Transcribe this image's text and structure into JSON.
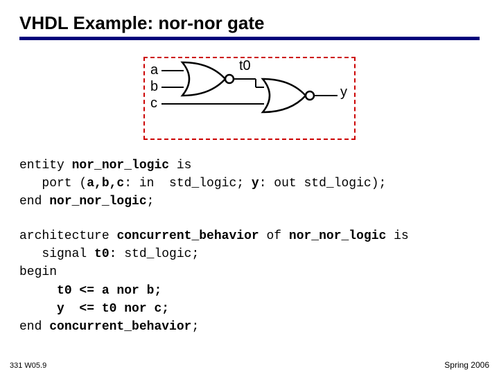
{
  "title": "VHDL Example: nor-nor gate",
  "labels": {
    "a": "a",
    "b": "b",
    "c": "c",
    "t0": "t0",
    "y": "y"
  },
  "code1": {
    "l1a": "entity ",
    "l1b": "nor_nor_logic",
    "l1c": " is",
    "l2a": "   port (",
    "l2b": "a,b,c",
    "l2c": ": in  std_logic; ",
    "l2d": "y",
    "l2e": ": out std_logic);",
    "l3a": "end ",
    "l3b": "nor_nor_logic",
    "l3c": ";"
  },
  "code2": {
    "l1a": "architecture ",
    "l1b": "concurrent_behavior",
    "l1c": " of ",
    "l1d": "nor_nor_logic",
    "l1e": " is",
    "l2a": "   signal ",
    "l2b": "t0",
    "l2c": ": std_logic;",
    "l3": "begin",
    "l4a": "     ",
    "l4b": "t0 <= a nor b;",
    "l5a": "     ",
    "l5b": "y  <= t0 nor c;",
    "l6a": "end ",
    "l6b": "concurrent_behavior",
    "l6c": ";"
  },
  "footer": {
    "left": "331  W05.9",
    "right": "Spring 2006"
  }
}
